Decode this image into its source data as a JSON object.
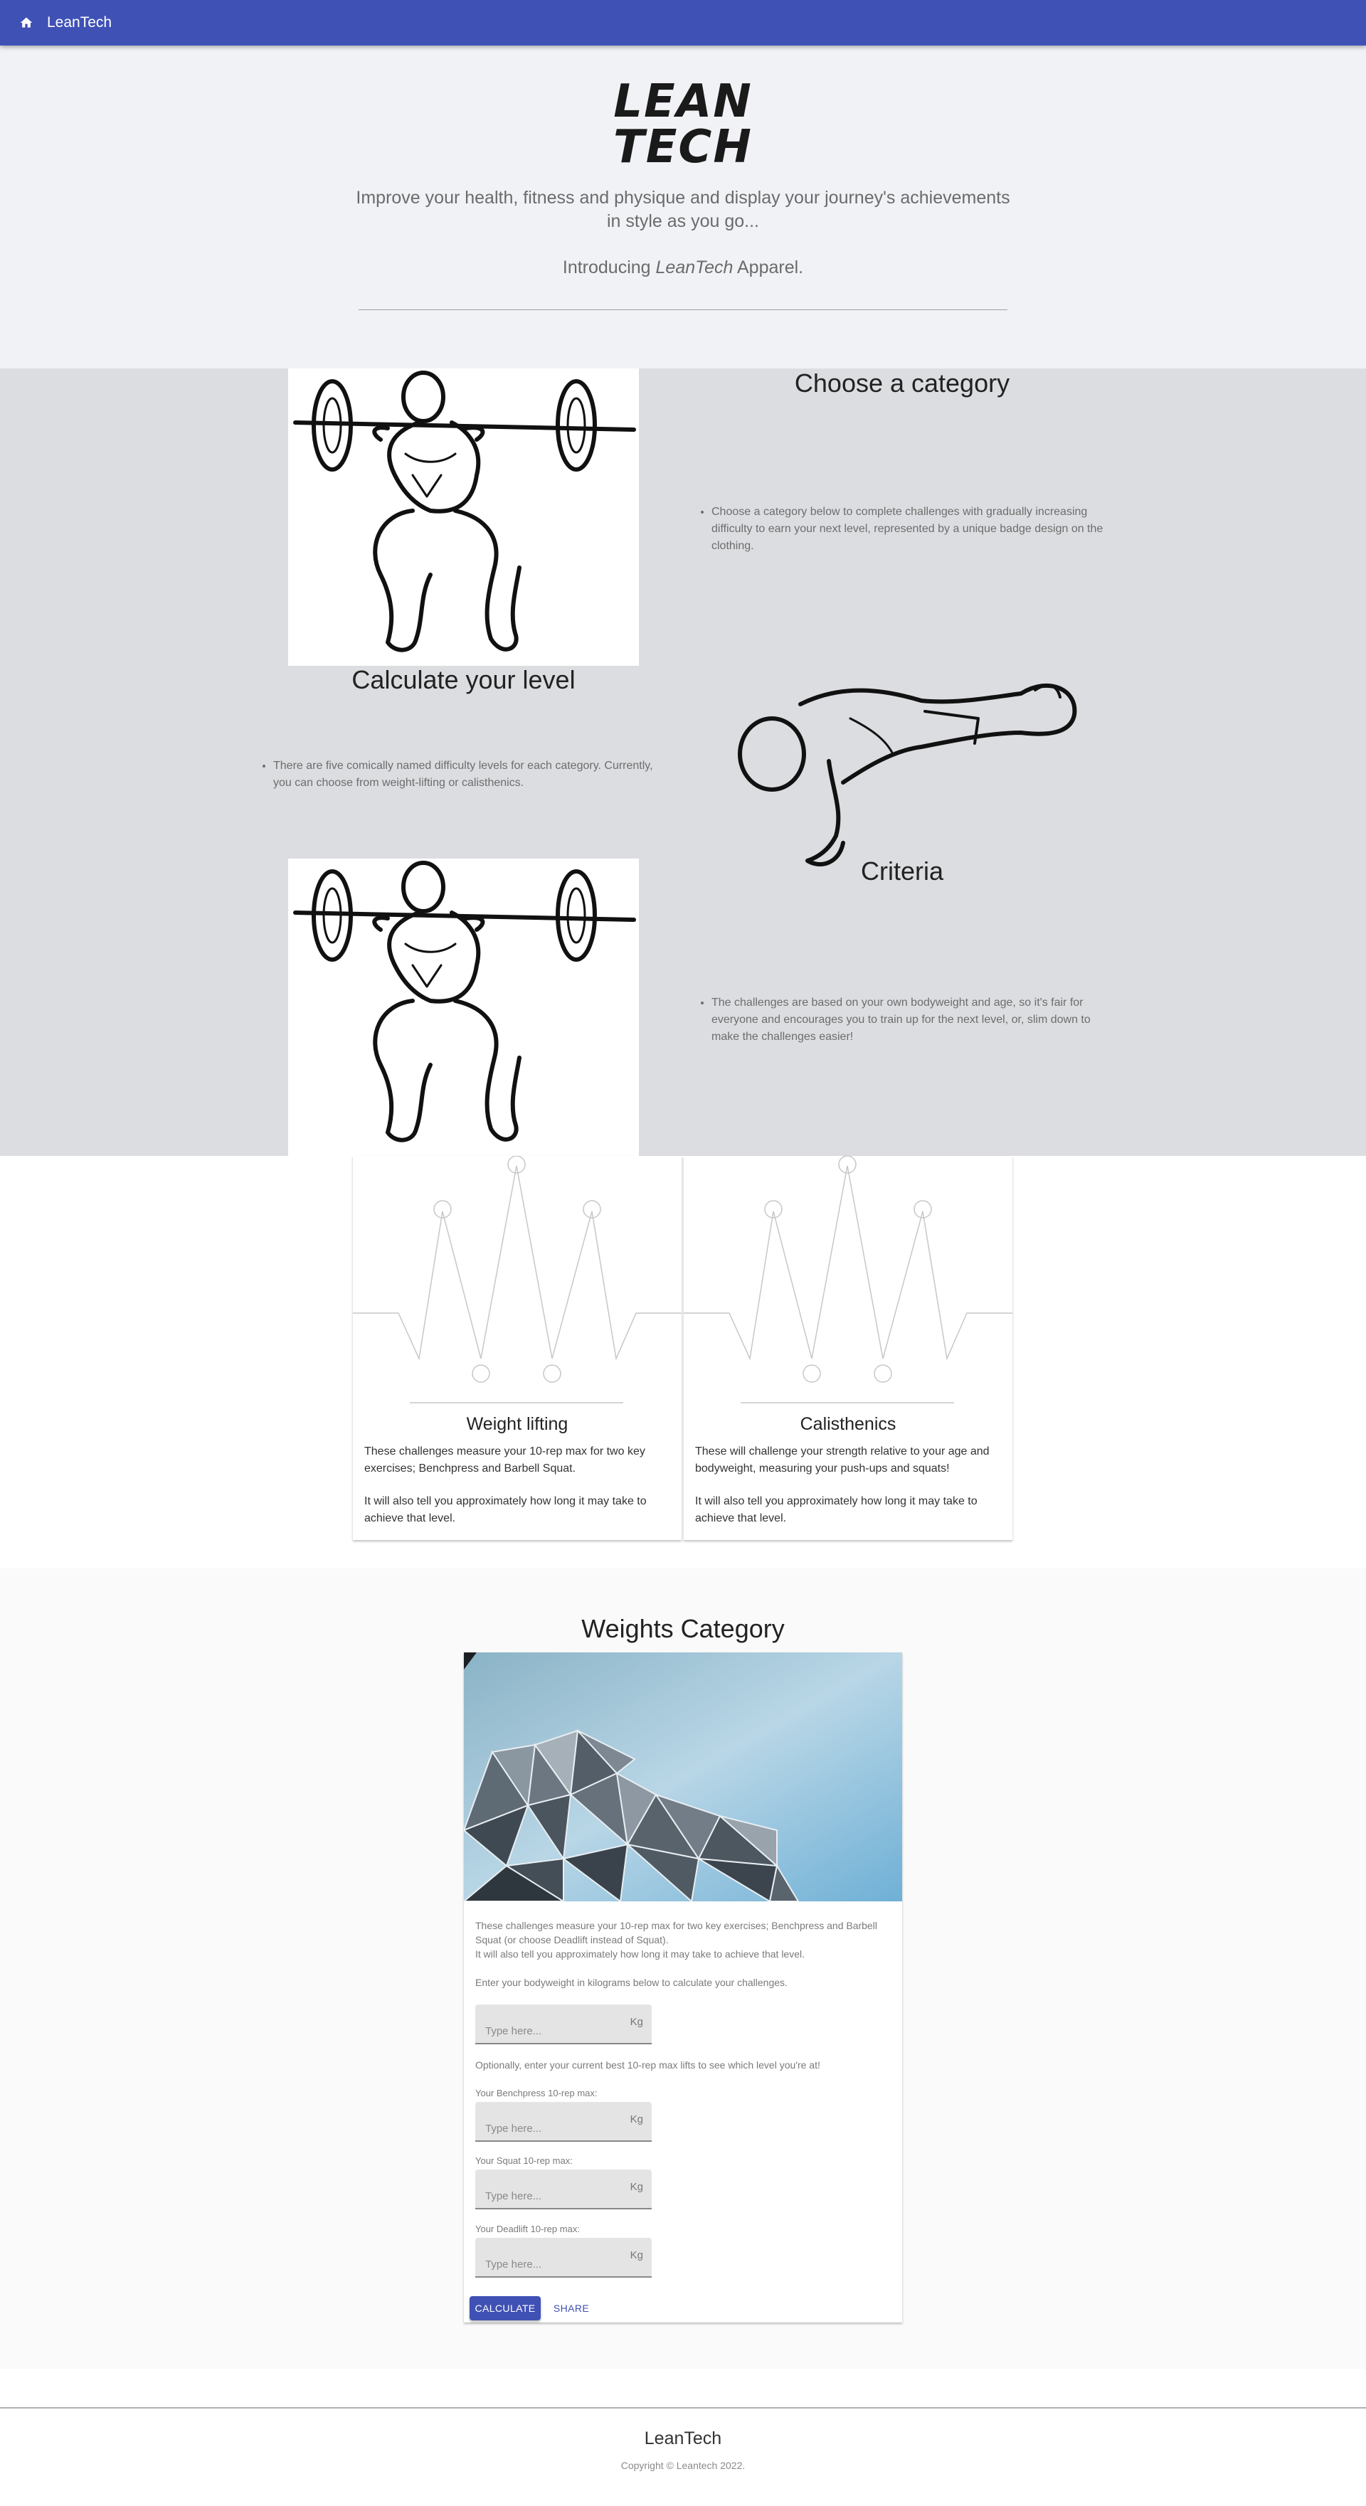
{
  "appbar": {
    "title": "LeanTech",
    "home_icon": "home-icon"
  },
  "hero": {
    "logo_line1": "LEAN",
    "logo_line2": "TECH",
    "tagline": "Improve your health, fitness and physique and display your journey's achievements in style as you go...",
    "intro_prefix": "Introducing ",
    "intro_brand": "LeanTech",
    "intro_suffix": " Apparel."
  },
  "info": {
    "choose": {
      "title": "Choose a category",
      "text": "Choose a category below to complete challenges with gradually increasing difficulty to earn your next level, represented by a unique badge design on the clothing."
    },
    "calculate": {
      "title": "Calculate your level",
      "text": "There are five comically named difficulty levels for each category. Currently, you can choose from weight-lifting or calisthenics."
    },
    "criteria": {
      "title": "Criteria",
      "text": "The challenges are based on your own bodyweight and age, so it's fair for everyone and encourages you to train up for the next level, or, slim down to make the challenges easier!"
    }
  },
  "categories": [
    {
      "title": "Weight lifting",
      "p1": "These challenges measure your 10-rep max for two key exercises; Benchpress and Barbell Squat.",
      "p2": "It will also tell you approximately how long it may take to achieve that level."
    },
    {
      "title": "Calisthenics",
      "p1": "These will challenge your strength relative to your age and bodyweight, measuring your push-ups and squats!",
      "p2": "It will also tell you approximately how long it may take to achieve that level."
    }
  ],
  "weights": {
    "title": "Weights Category",
    "desc1": "These challenges measure your 10-rep max for two key exercises; Benchpress and Barbell",
    "desc2": "Squat (or choose Deadlift instead of Squat).",
    "desc3": "It will also tell you approximately how long it may take to achieve that level.",
    "bodyweight_prompt": "Enter your bodyweight in kilograms below to calculate your challenges.",
    "optional_prompt": "Optionally, enter your current best 10-rep max lifts to see which level you're at!",
    "placeholder": "Type here...",
    "unit": "Kg",
    "bench_label": "Your Benchpress 10-rep max:",
    "squat_label": "Your Squat 10-rep max:",
    "deadlift_label": "Your Deadlift 10-rep max:",
    "calculate_label": "CALCULATE",
    "share_label": "SHARE"
  },
  "footer": {
    "name": "LeanTech",
    "copyright": "Copyright © Leantech 2022."
  },
  "colors": {
    "primary": "#3f51b5",
    "hero_bg": "#f1f2f6",
    "band_bg": "#dcdde0"
  }
}
